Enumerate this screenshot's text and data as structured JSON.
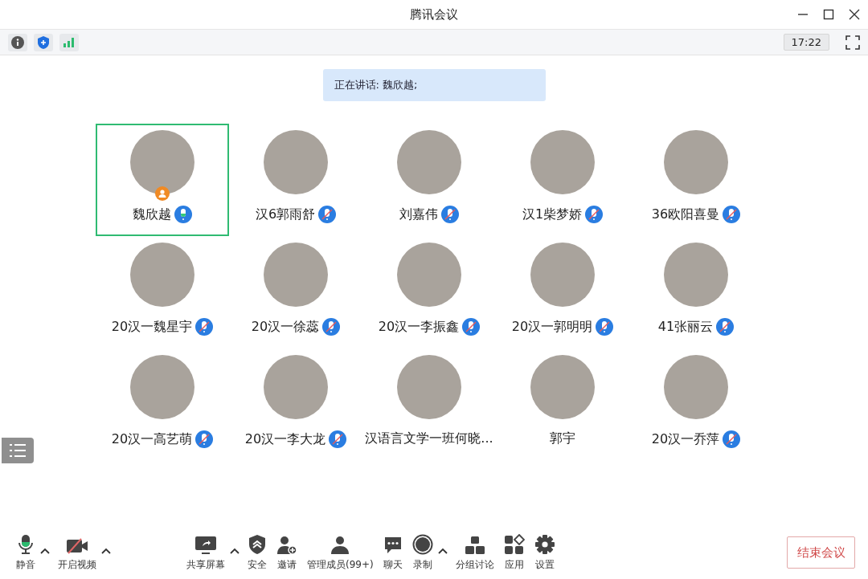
{
  "window": {
    "title": "腾讯会议"
  },
  "status_bar": {
    "time": "17:22"
  },
  "speaking_banner": "正在讲话: 魏欣越;",
  "participants": [
    {
      "name": "魏欣越",
      "speaking": true,
      "muted": false,
      "selected": true,
      "host": true
    },
    {
      "name": "汉6郭雨舒",
      "speaking": false,
      "muted": true,
      "selected": false,
      "host": false
    },
    {
      "name": "刘嘉伟",
      "speaking": false,
      "muted": true,
      "selected": false,
      "host": false
    },
    {
      "name": "汉1柴梦娇",
      "speaking": false,
      "muted": true,
      "selected": false,
      "host": false
    },
    {
      "name": "36欧阳喜曼",
      "speaking": false,
      "muted": true,
      "selected": false,
      "host": false
    },
    {
      "name": "20汉一魏星宇",
      "speaking": false,
      "muted": true,
      "selected": false,
      "host": false
    },
    {
      "name": "20汉一徐蕊",
      "speaking": false,
      "muted": true,
      "selected": false,
      "host": false
    },
    {
      "name": "20汉一李振鑫",
      "speaking": false,
      "muted": true,
      "selected": false,
      "host": false
    },
    {
      "name": "20汉一郭明明",
      "speaking": false,
      "muted": true,
      "selected": false,
      "host": false
    },
    {
      "name": "41张丽云",
      "speaking": false,
      "muted": true,
      "selected": false,
      "host": false
    },
    {
      "name": "20汉一高艺萌",
      "speaking": false,
      "muted": true,
      "selected": false,
      "host": false
    },
    {
      "name": "20汉一李大龙",
      "speaking": false,
      "muted": true,
      "selected": false,
      "host": false
    },
    {
      "name": "汉语言文学一班何晓...",
      "speaking": false,
      "muted": false,
      "selected": false,
      "host": false
    },
    {
      "name": "郭宇",
      "speaking": false,
      "muted": false,
      "selected": false,
      "host": false
    },
    {
      "name": "20汉一乔萍",
      "speaking": false,
      "muted": true,
      "selected": false,
      "host": false
    }
  ],
  "toolbar_left": [
    {
      "kind": "mic",
      "label": "静音",
      "caret": true
    },
    {
      "kind": "video-off",
      "label": "开启视频",
      "caret": true
    }
  ],
  "toolbar_center": [
    {
      "kind": "share",
      "label": "共享屏幕",
      "caret": true
    },
    {
      "kind": "security",
      "label": "安全",
      "caret": false
    },
    {
      "kind": "invite",
      "label": "邀请",
      "caret": false
    },
    {
      "kind": "members",
      "label": "管理成员(99+)",
      "caret": false
    },
    {
      "kind": "chat",
      "label": "聊天",
      "caret": false
    },
    {
      "kind": "record",
      "label": "录制",
      "caret": true
    },
    {
      "kind": "breakout",
      "label": "分组讨论",
      "caret": false
    },
    {
      "kind": "apps",
      "label": "应用",
      "caret": false
    },
    {
      "kind": "settings",
      "label": "设置",
      "caret": false
    }
  ],
  "end_button": "结束会议"
}
